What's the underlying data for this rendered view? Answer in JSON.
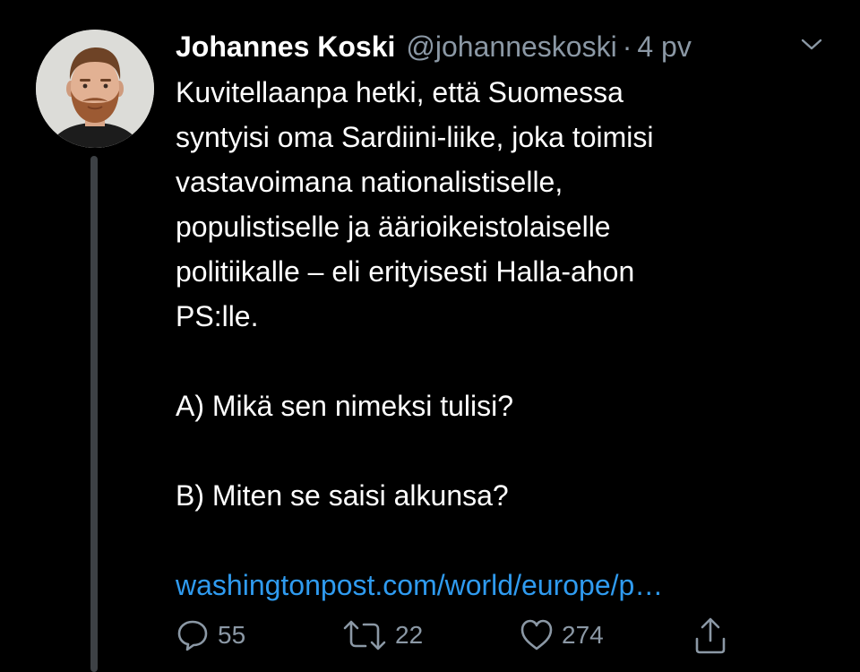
{
  "tweet": {
    "author": {
      "name": "Johannes Koski",
      "handle": "@johanneskoski",
      "separator": "·",
      "time": "4 pv"
    },
    "body_lines": [
      "Kuvitellaanpa hetki, että Suomessa",
      "syntyisi oma Sardiini-liike, joka toimisi",
      "vastavoimana nationalistiselle,",
      "populistiselle ja äärioikeistolaiselle",
      "politiikalle – eli erityisesti Halla-ahon",
      "PS:lle."
    ],
    "question_a": "A) Mikä sen nimeksi tulisi?",
    "question_b": "B) Miten se saisi alkunsa?",
    "link": "washingtonpost.com/world/europe/p…",
    "actions": {
      "replies": "55",
      "retweets": "22",
      "likes": "274"
    },
    "icons": {
      "menu": "chevron-down-icon",
      "reply": "reply-icon",
      "retweet": "retweet-icon",
      "like": "heart-icon",
      "share": "share-icon"
    },
    "colors": {
      "background": "#000000",
      "text": "#ffffff",
      "muted": "#8b98a5",
      "link": "#2f9bf0",
      "thread_line": "#3d4145"
    }
  }
}
